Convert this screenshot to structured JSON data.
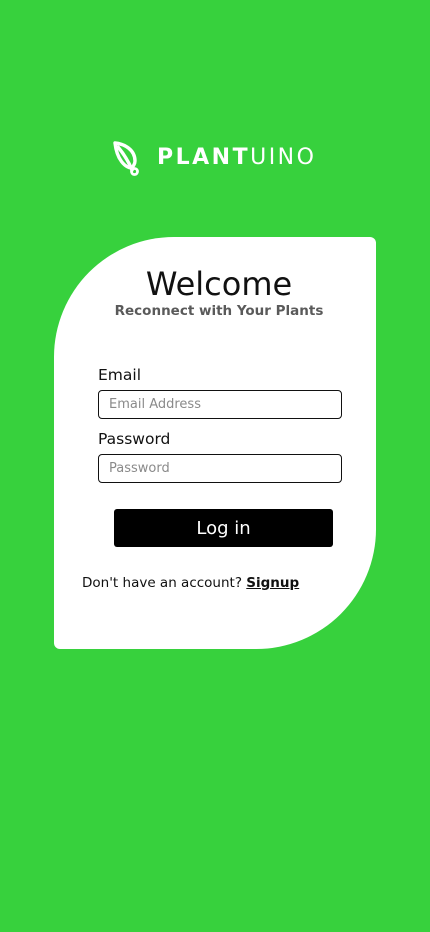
{
  "brand": {
    "name_bold": "PLANT",
    "name_light": "UINO",
    "icon": "leaf-sprout-icon",
    "color": "#ffffff"
  },
  "colors": {
    "background": "#37d13d",
    "card": "#ffffff",
    "button": "#000000"
  },
  "login": {
    "title": "Welcome",
    "subtitle": "Reconnect with Your Plants",
    "email_label": "Email",
    "email_placeholder": "Email Address",
    "email_value": "",
    "password_label": "Password",
    "password_placeholder": "Password",
    "password_value": "",
    "submit_label": "Log in",
    "signup_prompt": "Don't have an account?",
    "signup_link": "Signup"
  }
}
